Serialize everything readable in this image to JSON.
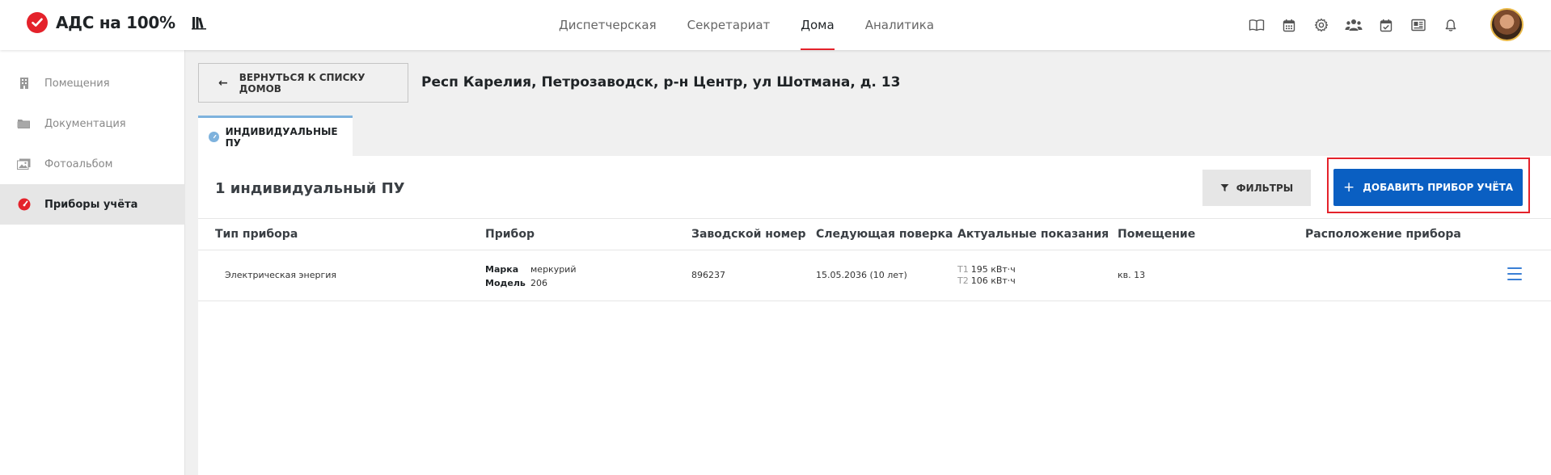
{
  "app": {
    "logo_text": "АДС на 100%",
    "brand_color": "#e4222b",
    "accent_color": "#0a5fc2"
  },
  "nav": {
    "items": [
      {
        "label": "Диспетчерская",
        "active": false
      },
      {
        "label": "Секретариат",
        "active": false
      },
      {
        "label": "Дома",
        "active": true
      },
      {
        "label": "Аналитика",
        "active": false
      }
    ]
  },
  "header_icons": [
    "book-icon",
    "calendar-icon",
    "gear-icon",
    "users-icon",
    "calendar-check-icon",
    "news-icon",
    "bell-icon"
  ],
  "sidebar": {
    "items": [
      {
        "label": "Помещения",
        "icon": "building-icon",
        "active": false
      },
      {
        "label": "Документация",
        "icon": "folder-icon",
        "active": false
      },
      {
        "label": "Фотоальбом",
        "icon": "photo-icon",
        "active": false
      },
      {
        "label": "Приборы учёта",
        "icon": "gauge-icon",
        "active": true
      }
    ]
  },
  "main": {
    "back_label": "ВЕРНУТЬСЯ К СПИСКУ ДОМОВ",
    "address": "Респ Карелия, Петрозаводск, р-н Центр, ул Шотмана, д. 13",
    "tab_label": "ИНДИВИДУАЛЬНЫЕ ПУ",
    "count_title": "1 индивидуальный ПУ",
    "filter_label": "ФИЛЬТРЫ",
    "add_label": "ДОБАВИТЬ ПРИБОР УЧЁТА"
  },
  "table": {
    "columns": [
      "Тип прибора",
      "Прибор",
      "Заводской номер",
      "Следующая поверка",
      "Актуальные показания",
      "Помещение",
      "Расположение прибора"
    ],
    "rows": [
      {
        "type": "Электрическая энергия",
        "brand_key": "Марка",
        "brand_value": "меркурий",
        "model_key": "Модель",
        "model_value": "206",
        "serial": "896237",
        "next_check": "15.05.2036 (10 лет)",
        "t1_label": "T1",
        "t1_value": "195 кВт⋅ч",
        "t2_label": "T2",
        "t2_value": "106 кВт⋅ч",
        "room": "кв. 13",
        "location": ""
      }
    ]
  }
}
